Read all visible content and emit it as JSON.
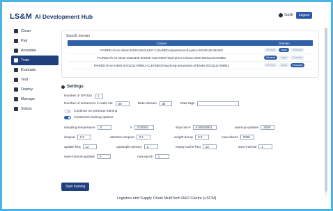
{
  "header": {
    "logo": "LS&M",
    "title": "AI Development Hub",
    "user": "lscm",
    "logout": "Logout"
  },
  "sidebar": {
    "items": [
      {
        "label": "Clean",
        "icon": "broom-icon"
      },
      {
        "label": "Pair",
        "icon": "pair-icon"
      },
      {
        "label": "Annotate",
        "icon": "annotate-icon"
      },
      {
        "label": "Train",
        "icon": "train-icon"
      },
      {
        "label": "Evaluate",
        "icon": "evaluate-icon"
      },
      {
        "label": "Test",
        "icon": "test-icon"
      },
      {
        "label": "Deploy",
        "icon": "deploy-icon"
      },
      {
        "label": "Manage",
        "icon": "manage-icon"
      },
      {
        "label": "Status",
        "icon": "status-icon"
      }
    ]
  },
  "domain": {
    "label": "Specify domain",
    "columns": [
      "Corpus",
      "Domain"
    ],
    "rows": [
      {
        "name": "PAIRED-zh-en-mbart-20220119-011407-CLEANED-department-of-justice-20220119-092203",
        "selected": "Legal"
      },
      {
        "name": "PAIRED-zh-en-mbart-20211126-021936-CLEANED-hkust-press-release-2000-20211123-010806",
        "selected": "General"
      },
      {
        "name": "PAIRED-zh-en-mbart-20211111-095811-CLEANED-hong-kong-association-of-banks-20211111-095811",
        "selected": "Financial"
      }
    ],
    "options": [
      "General",
      "Legal",
      "Financial"
    ]
  },
  "settings": {
    "title": "Settings",
    "gpus_label": "Number of GPU(s)",
    "gpus_value": "1",
    "valid_label": "Number of sentences in valid set",
    "valid_value": "50",
    "domain_label": "Data domain",
    "domain_value": "all",
    "tags_label": "Data tags",
    "tags_value": "",
    "continue_label": "Continue on previous training",
    "customize_label": "Customize training options",
    "params": [
      {
        "name": "sampling-temperature",
        "value": "5"
      },
      {
        "name": "lr",
        "value": "0.00003"
      },
      {
        "name": "stop-min-lr",
        "value": "0.00000001"
      },
      {
        "name": "warmup-updates",
        "value": "2000"
      },
      {
        "name": "dropout",
        "value": "0.3"
      },
      {
        "name": "attention-dropout",
        "value": "0.1"
      },
      {
        "name": "weight-decay",
        "value": "0.0"
      },
      {
        "name": "max-tokens",
        "value": "2048"
      },
      {
        "name": "update-freq",
        "value": "12"
      },
      {
        "name": "upsample-primary",
        "value": "2"
      },
      {
        "name": "empty-cache-freq",
        "value": "10"
      },
      {
        "name": "save-interval",
        "value": "1"
      },
      {
        "name": "save-interval-updates",
        "value": "0"
      },
      {
        "name": "max-epoch",
        "value": "1"
      }
    ]
  },
  "actions": {
    "start": "Start training"
  },
  "footer": "Logistics and Supply Chain MultiTech R&D Centre (LSCM)"
}
